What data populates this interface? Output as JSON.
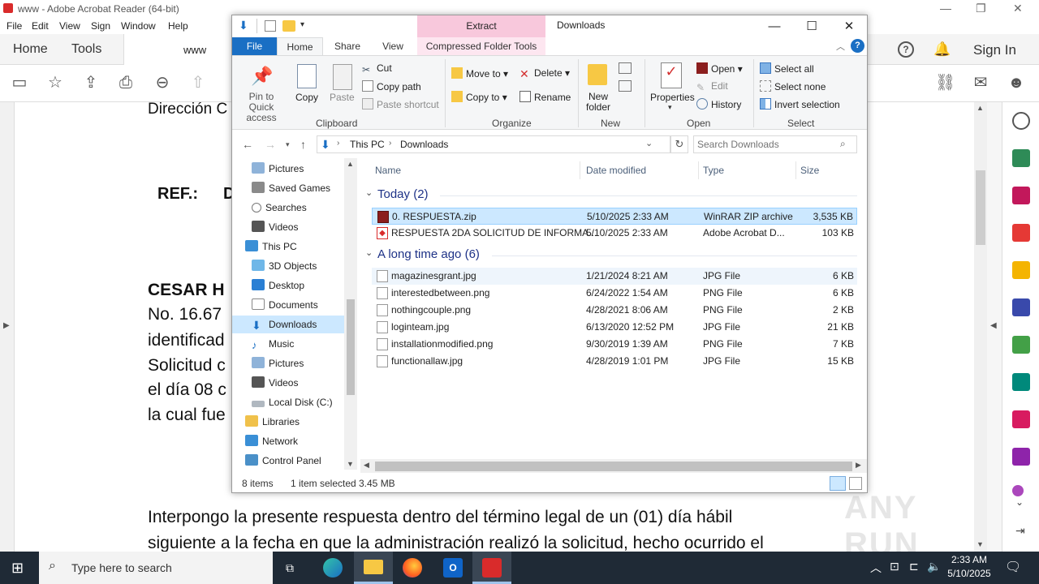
{
  "acrobat": {
    "window_title": "www - Adobe Acrobat Reader (64-bit)",
    "menu": [
      "File",
      "Edit",
      "View",
      "Sign",
      "Window",
      "Help"
    ],
    "tabs": {
      "home": "Home",
      "tools": "Tools",
      "document": "www"
    },
    "sign_in": "Sign In",
    "doc_lines": [
      "Dirección C",
      "REF.:",
      "CESAR H",
      "No. 16.67",
      "identificad",
      "Solicitud c",
      "el día 08 c",
      "la cual fue",
      "Interpongo la presente respuesta dentro del término legal de un (01) día hábil",
      "siguiente a la fecha en que la administración realizó la solicitud, hecho ocurrido el"
    ],
    "ref_d": "D"
  },
  "explorer": {
    "title": "Downloads",
    "extract_label": "Extract",
    "ribbon_tabs": {
      "file": "File",
      "home": "Home",
      "share": "Share",
      "view": "View",
      "cft": "Compressed Folder Tools"
    },
    "clipboard": {
      "pin": "Pin to Quick access",
      "copy": "Copy",
      "paste": "Paste",
      "cut": "Cut",
      "copy_path": "Copy path",
      "paste_shortcut": "Paste shortcut",
      "label": "Clipboard"
    },
    "organize": {
      "move_to": "Move to",
      "copy_to": "Copy to",
      "delete": "Delete",
      "rename": "Rename",
      "label": "Organize"
    },
    "new_group": {
      "new_folder": "New folder",
      "label": "New"
    },
    "open_group": {
      "properties": "Properties",
      "open": "Open",
      "edit": "Edit",
      "history": "History",
      "label": "Open"
    },
    "select_group": {
      "select_all": "Select all",
      "select_none": "Select none",
      "invert": "Invert selection",
      "label": "Select"
    },
    "breadcrumb": [
      "This PC",
      "Downloads"
    ],
    "search_placeholder": "Search Downloads",
    "nav": [
      "Pictures",
      "Saved Games",
      "Searches",
      "Videos",
      "This PC",
      "3D Objects",
      "Desktop",
      "Documents",
      "Downloads",
      "Music",
      "Pictures",
      "Videos",
      "Local Disk (C:)",
      "Libraries",
      "Network",
      "Control Panel"
    ],
    "columns": {
      "name": "Name",
      "date": "Date modified",
      "type": "Type",
      "size": "Size"
    },
    "groups": {
      "today": "Today (2)",
      "longtime": "A long time ago (6)"
    },
    "today_files": [
      {
        "name": "0. RESPUESTA.zip",
        "date": "5/10/2025 2:33 AM",
        "type": "WinRAR ZIP archive",
        "size": "3,535 KB"
      },
      {
        "name": "RESPUESTA 2DA SOLICITUD DE INFORMA...",
        "date": "5/10/2025 2:33 AM",
        "type": "Adobe Acrobat D...",
        "size": "103 KB"
      }
    ],
    "old_files": [
      {
        "name": "magazinesgrant.jpg",
        "date": "1/21/2024 8:21 AM",
        "type": "JPG File",
        "size": "6 KB"
      },
      {
        "name": "interestedbetween.png",
        "date": "6/24/2022 1:54 AM",
        "type": "PNG File",
        "size": "6 KB"
      },
      {
        "name": "nothingcouple.png",
        "date": "4/28/2021 8:06 AM",
        "type": "PNG File",
        "size": "2 KB"
      },
      {
        "name": "loginteam.jpg",
        "date": "6/13/2020 12:52 PM",
        "type": "JPG File",
        "size": "21 KB"
      },
      {
        "name": "installationmodified.png",
        "date": "9/30/2019 1:39 AM",
        "type": "PNG File",
        "size": "7 KB"
      },
      {
        "name": "functionallaw.jpg",
        "date": "4/28/2019 1:01 PM",
        "type": "JPG File",
        "size": "15 KB"
      }
    ],
    "status": {
      "count": "8 items",
      "selected": "1 item selected",
      "size": "3.45 MB"
    }
  },
  "taskbar": {
    "search_placeholder": "Type here to search",
    "time": "2:33 AM",
    "date": "5/10/2025"
  },
  "watermark": "ANY RUN",
  "colors": {
    "accent": "#1a6fc4",
    "selection": "#cce8ff",
    "acrobat_red": "#d92b2b",
    "taskbar": "#1f2a36"
  }
}
